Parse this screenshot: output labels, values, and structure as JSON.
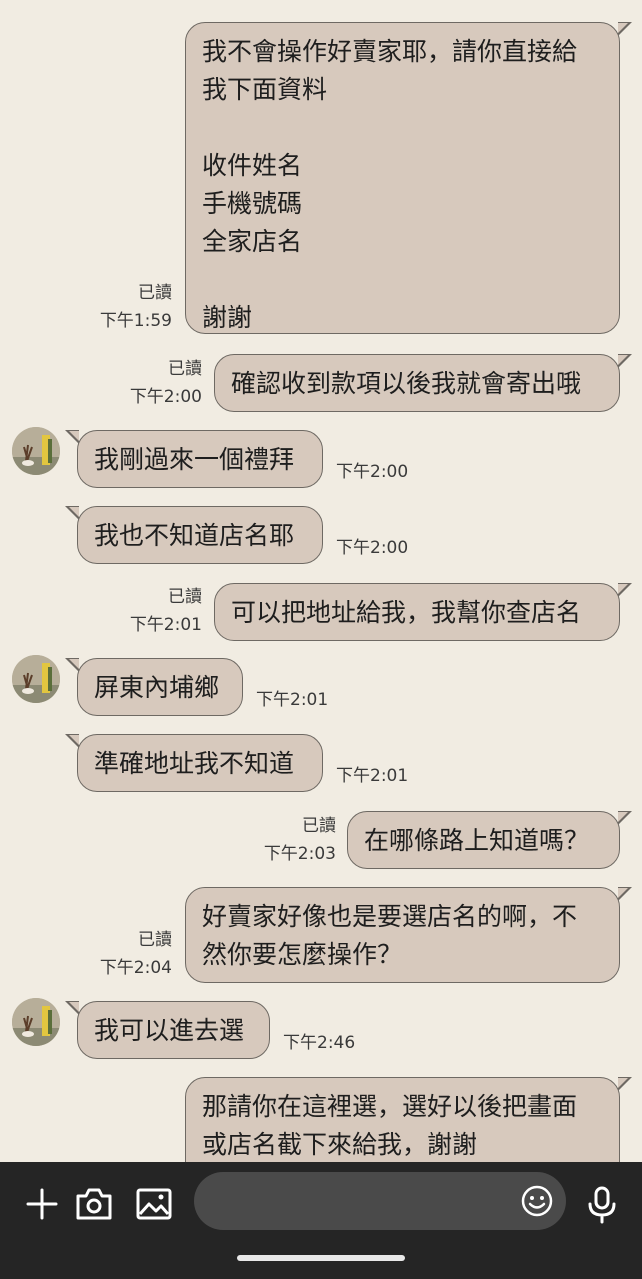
{
  "messages": [
    {
      "side": "out",
      "text": "我不會操作好賣家耶，請你直接給\n我下面資料\n\n收件姓名\n手機號碼\n全家店名\n\n謝謝",
      "read": "已讀",
      "time": "下午1:59"
    },
    {
      "side": "out",
      "text": "確認收到款項以後我就會寄出哦",
      "read": "已讀",
      "time": "下午2:00"
    },
    {
      "side": "in",
      "text": "我剛過來一個禮拜",
      "time": "下午2:00"
    },
    {
      "side": "in",
      "text": "我也不知道店名耶",
      "time": "下午2:00"
    },
    {
      "side": "out",
      "text": "可以把地址給我，我幫你查店名",
      "read": "已讀",
      "time": "下午2:01"
    },
    {
      "side": "in",
      "text": "屏東內埔鄉",
      "time": "下午2:01"
    },
    {
      "side": "in",
      "text": "準確地址我不知道",
      "time": "下午2:01"
    },
    {
      "side": "out",
      "text": "在哪條路上知道嗎？",
      "read": "已讀",
      "time": "下午2:03"
    },
    {
      "side": "out",
      "text": "好賣家好像也是要選店名的啊，不\n然你要怎麼操作？",
      "read": "已讀",
      "time": "下午2:04"
    },
    {
      "side": "in",
      "text": "我可以進去選",
      "time": "下午2:46"
    },
    {
      "side": "out",
      "text": "那請你在這裡選，選好以後把畫面\n或店名截下來給我，謝謝",
      "read": "",
      "time": ""
    }
  ],
  "bottom_bar": {
    "icons": [
      "plus-icon",
      "camera-icon",
      "image-icon",
      "emoji-icon",
      "microphone-icon"
    ],
    "input_placeholder": ""
  },
  "colors": {
    "background": "#f1ece2",
    "bubble": "#d7c9bd",
    "bubble_border": "#6e6963",
    "bottom_bar": "#252525"
  }
}
